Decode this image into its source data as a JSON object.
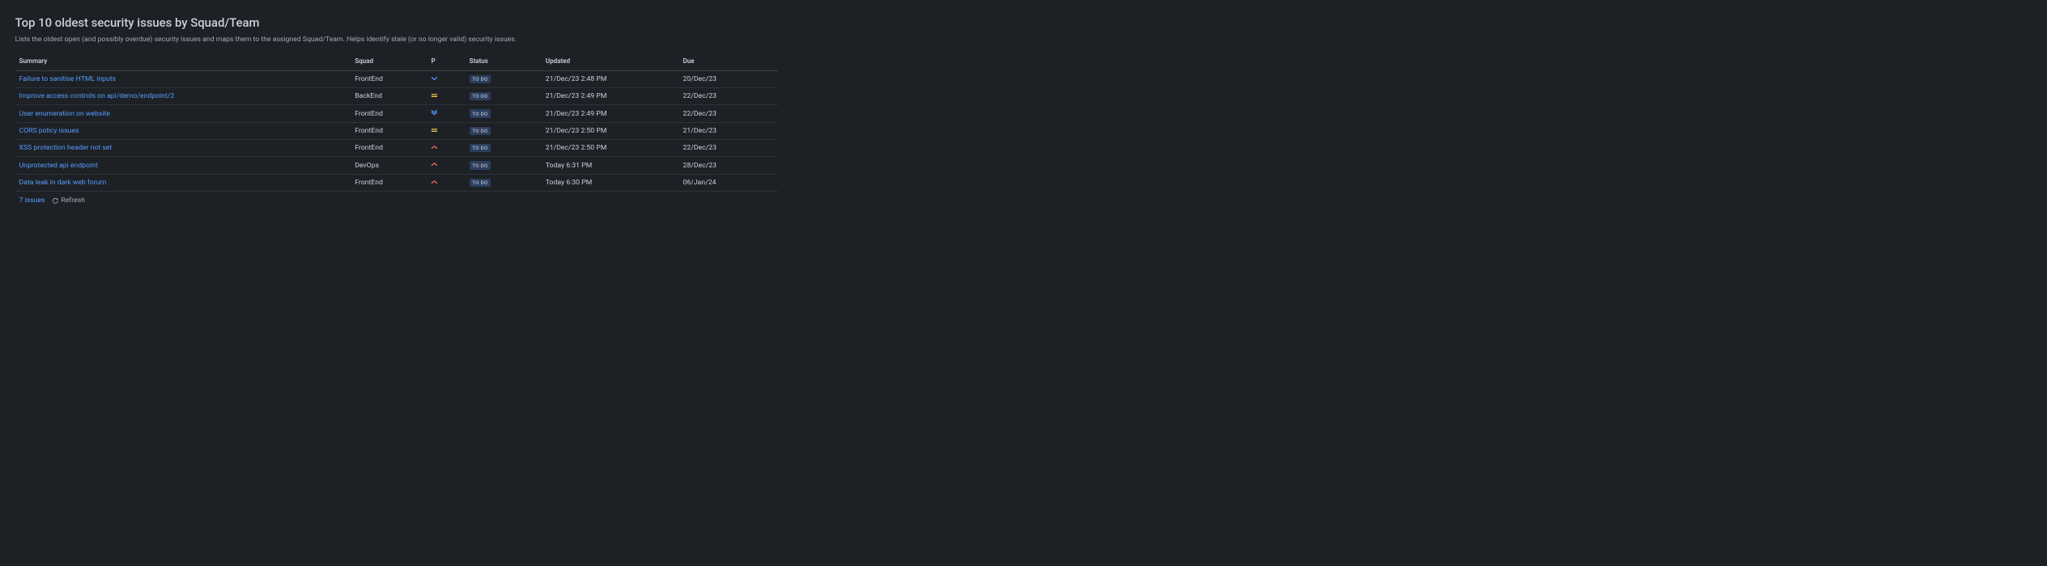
{
  "title": "Top 10 oldest security issues by Squad/Team",
  "description": "Lists the oldest open (and possibly overdue) security issues and maps them to the assigned Squad/Team. Helps identify stale (or no longer valid) security issues.",
  "columns": {
    "summary": "Summary",
    "squad": "Squad",
    "p": "P",
    "status": "Status",
    "updated": "Updated",
    "due": "Due"
  },
  "issues": [
    {
      "summary": "Failure to sanitise HTML inputs",
      "squad": "FrontEnd",
      "priority": "low",
      "status": "TO DO",
      "updated": "21/Dec/23 2:48 PM",
      "due": "20/Dec/23"
    },
    {
      "summary": "Improve access controls on api/demo/endpoint/2",
      "squad": "BackEnd",
      "priority": "medium",
      "status": "TO DO",
      "updated": "21/Dec/23 2:49 PM",
      "due": "22/Dec/23"
    },
    {
      "summary": "User enumeration on website",
      "squad": "FrontEnd",
      "priority": "lowest",
      "status": "TO DO",
      "updated": "21/Dec/23 2:49 PM",
      "due": "22/Dec/23"
    },
    {
      "summary": "CORS policy issues",
      "squad": "FrontEnd",
      "priority": "medium",
      "status": "TO DO",
      "updated": "21/Dec/23 2:50 PM",
      "due": "21/Dec/23"
    },
    {
      "summary": "XSS protection header not set",
      "squad": "FrontEnd",
      "priority": "high",
      "status": "TO DO",
      "updated": "21/Dec/23 2:50 PM",
      "due": "22/Dec/23"
    },
    {
      "summary": "Unprotected api endpoint",
      "squad": "DevOps",
      "priority": "high",
      "status": "TO DO",
      "updated": "Today 6:31 PM",
      "due": "28/Dec/23"
    },
    {
      "summary": "Data leak in dark web forum",
      "squad": "FrontEnd",
      "priority": "high",
      "status": "TO DO",
      "updated": "Today 6:30 PM",
      "due": "06/Jan/24"
    }
  ],
  "footer": {
    "issue_count": "7 issues",
    "refresh_label": "Refresh"
  }
}
